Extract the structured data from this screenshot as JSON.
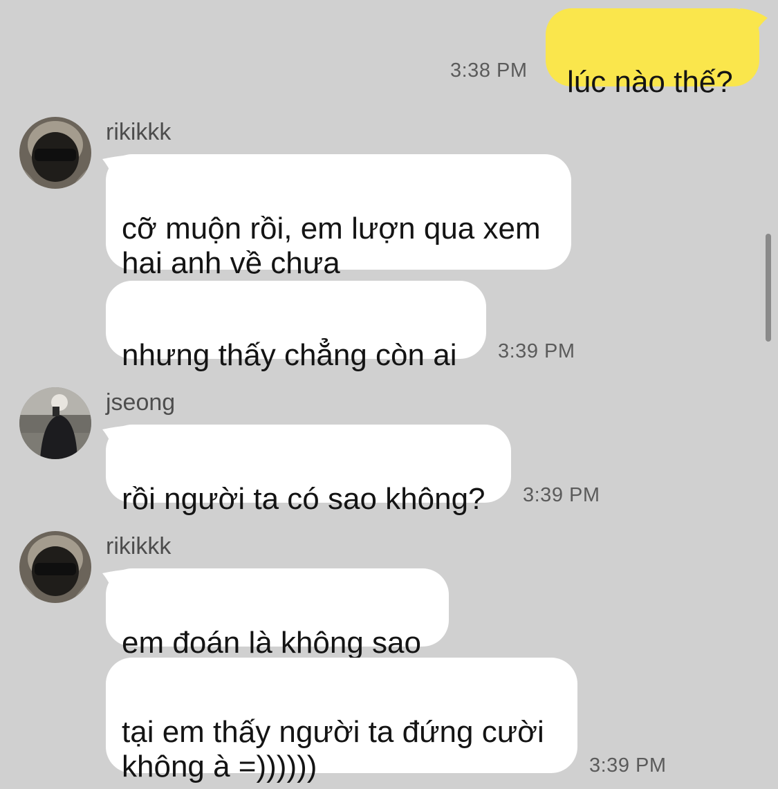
{
  "messages": [
    {
      "sender": "me",
      "text": "lúc nào thế?",
      "time": "3:38 PM"
    },
    {
      "sender": "rikikkk",
      "text": "cỡ muộn rồi, em lượn qua xem\nhai anh về chưa"
    },
    {
      "sender": "rikikkk",
      "text": "nhưng thấy chẳng còn ai",
      "time": "3:39 PM"
    },
    {
      "sender": "jseong",
      "text": "rồi người ta có sao không?",
      "time": "3:39 PM"
    },
    {
      "sender": "rikikkk",
      "text": "em đoán là không sao"
    },
    {
      "sender": "rikikkk",
      "text": "tại em thấy người ta đứng cười\nkhông à =))))))",
      "time": "3:39 PM"
    }
  ],
  "senders": {
    "group1": "rikikkk",
    "group2": "jseong",
    "group3": "rikikkk"
  },
  "colors": {
    "background": "#d0d0d0",
    "incoming_bubble": "#ffffff",
    "outgoing_bubble": "#fae64c"
  }
}
